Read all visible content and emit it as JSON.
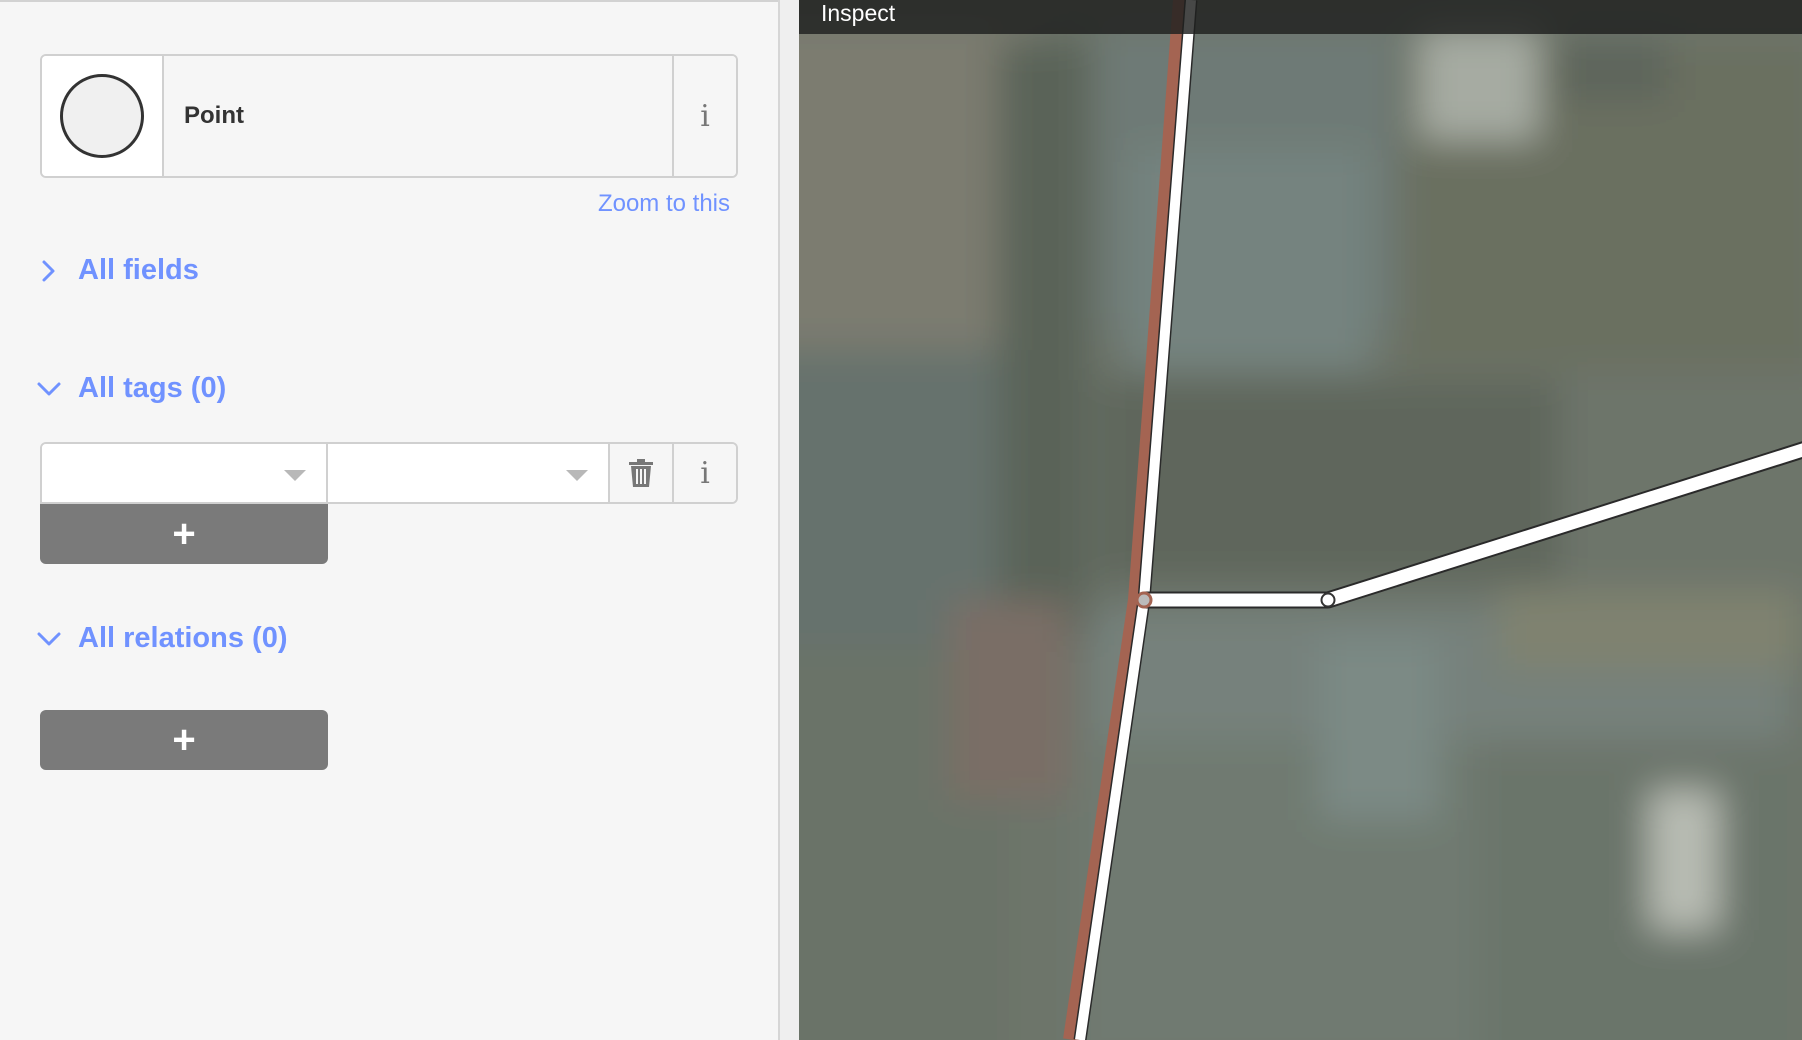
{
  "sidebar": {
    "preset": {
      "name": "Point",
      "icon": "point-circle-icon",
      "info_icon": "i"
    },
    "zoom_link": "Zoom to this",
    "sections": {
      "fields": {
        "label": "All fields",
        "expanded": false
      },
      "tags": {
        "label": "All tags (0)",
        "expanded": true
      },
      "relations": {
        "label": "All relations (0)",
        "expanded": true
      }
    },
    "tag_editor": {
      "key_value": "",
      "value_value": "",
      "info_icon": "i",
      "add_label": "+"
    },
    "relations_add_label": "+"
  },
  "map": {
    "mode_title": "Inspect"
  },
  "colors": {
    "accent": "#7092ff",
    "button": "#7a7a7a",
    "way_highlight": "#a46452"
  }
}
